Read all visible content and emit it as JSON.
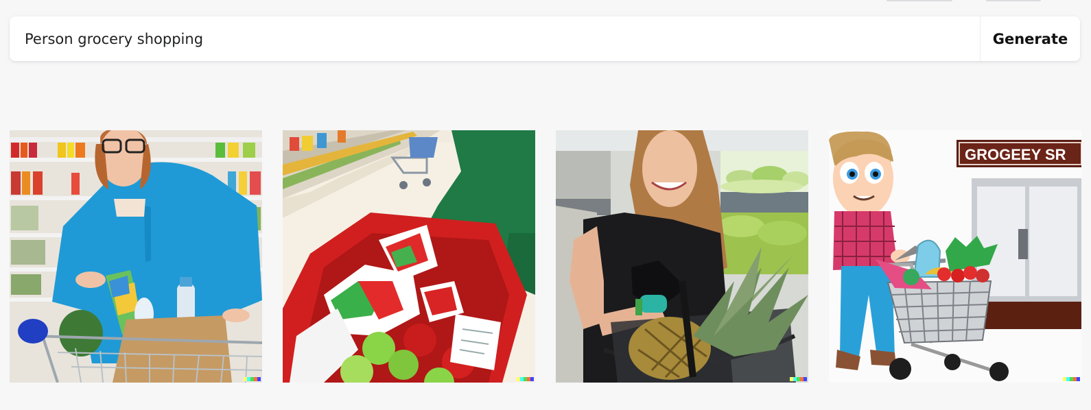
{
  "search": {
    "value": "Person grocery shopping",
    "button_label": "Generate"
  },
  "results": [
    {
      "id": "tile-1",
      "subject": "woman in blue shirt bagging groceries into a shopping cart"
    },
    {
      "id": "tile-2",
      "subject": "person in green sweater placing wrapped items and apples into a red cart"
    },
    {
      "id": "tile-3",
      "subject": "smiling woman holding a basket with a pineapple in produce aisle"
    },
    {
      "id": "tile-4",
      "subject": "cartoon boy pushing a shopping cart with vegetables outside a store"
    }
  ],
  "store_sign_text": "GROGEEY SR",
  "colors": {
    "accent": "#202123",
    "background": "#f7f7f8",
    "watermark": [
      "#ffff66",
      "#42ffff",
      "#51da4c",
      "#ff6e3c",
      "#3c46ff"
    ]
  }
}
